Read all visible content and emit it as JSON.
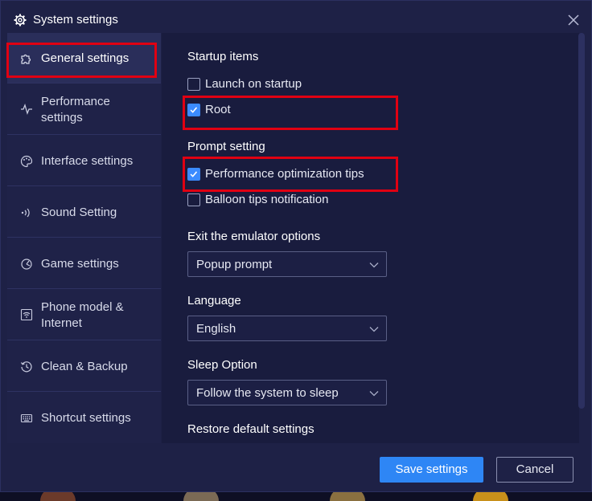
{
  "window": {
    "title": "System settings"
  },
  "sidebar": {
    "items": [
      {
        "label": "General settings",
        "icon": "puzzle-icon",
        "active": true
      },
      {
        "label_line1": "Performance",
        "label_line2": "settings",
        "icon": "pulse-icon"
      },
      {
        "label": "Interface settings",
        "icon": "palette-icon"
      },
      {
        "label": "Sound Setting",
        "icon": "sound-wave-icon"
      },
      {
        "label": "Game settings",
        "icon": "gamepad-icon"
      },
      {
        "label_line1": "Phone model &",
        "label_line2": "Internet",
        "icon": "wifi-icon"
      },
      {
        "label": "Clean & Backup",
        "icon": "history-icon"
      },
      {
        "label": "Shortcut settings",
        "icon": "keyboard-icon"
      }
    ]
  },
  "content": {
    "startup": {
      "title": "Startup items",
      "launch_on_startup": {
        "label": "Launch on startup",
        "checked": false
      },
      "root": {
        "label": "Root",
        "checked": true
      }
    },
    "prompt": {
      "title": "Prompt setting",
      "performance_tips": {
        "label": "Performance optimization tips",
        "checked": true
      },
      "balloon_tips": {
        "label": "Balloon tips notification",
        "checked": false
      }
    },
    "exit_options": {
      "title": "Exit the emulator options",
      "value": "Popup prompt"
    },
    "language": {
      "title": "Language",
      "value": "English"
    },
    "sleep": {
      "title": "Sleep Option",
      "value": "Follow the system to sleep"
    },
    "restore": {
      "title": "Restore default settings"
    }
  },
  "footer": {
    "save_label": "Save settings",
    "cancel_label": "Cancel"
  },
  "colors": {
    "accent": "#2e86f5",
    "checkbox": "#3b8bff",
    "highlight": "#e00012",
    "panel": "#1e2146"
  }
}
